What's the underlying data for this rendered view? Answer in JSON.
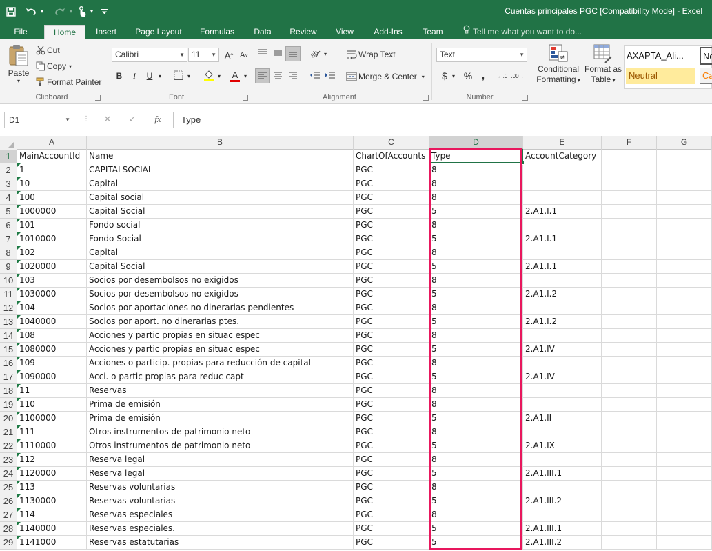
{
  "window": {
    "title": "Cuentas principales PGC  [Compatibility Mode] - Excel",
    "accent": "#217346",
    "highlight_color": "#e8175d"
  },
  "quick_access": {
    "save_icon": "save-icon",
    "undo_icon": "undo-icon",
    "redo_icon": "redo-icon",
    "touch_icon": "touch-mode-icon",
    "customize_icon": "customize-icon"
  },
  "tabs": [
    "File",
    "Home",
    "Insert",
    "Page Layout",
    "Formulas",
    "Data",
    "Review",
    "View",
    "Add-Ins",
    "Team"
  ],
  "active_tab": "Home",
  "tell_me": "Tell me what you want to do...",
  "ribbon": {
    "clipboard": {
      "paste": "Paste",
      "cut": "Cut",
      "copy": "Copy",
      "format_painter": "Format Painter",
      "label": "Clipboard"
    },
    "font": {
      "name": "Calibri",
      "size": "11",
      "label": "Font",
      "bold": "B",
      "italic": "I",
      "underline": "U",
      "grow": "A",
      "shrink": "A",
      "font_color_letter": "A"
    },
    "alignment": {
      "wrap_text": "Wrap Text",
      "merge_center": "Merge & Center",
      "label": "Alignment"
    },
    "number": {
      "format": "Text",
      "currency": "$",
      "percent": "%",
      "comma": ",",
      "increase_decimal": "←.0",
      "decrease_decimal": ".00→",
      "label": "Number"
    },
    "styles": {
      "conditional_formatting_1": "Conditional",
      "conditional_formatting_2": "Formatting",
      "format_as_table_1": "Format as",
      "format_as_table_2": "Table",
      "style_1": "AXAPTA_Ali...",
      "style_2": "Neutral",
      "style_3": "No",
      "style_4": "Ca"
    }
  },
  "formula_bar": {
    "name_box": "D1",
    "cancel": "✕",
    "enter": "✓",
    "fx": "fx",
    "content": "Type"
  },
  "sheet": {
    "columns": [
      "A",
      "B",
      "C",
      "D",
      "E",
      "F",
      "G"
    ],
    "selected_column": "D",
    "selected_cell": "D1",
    "row_numbers": [
      "1",
      "2",
      "3",
      "4",
      "5",
      "6",
      "7",
      "8",
      "9",
      "10",
      "11",
      "12",
      "13",
      "14",
      "15",
      "16",
      "17",
      "18",
      "19",
      "20",
      "21",
      "22",
      "23",
      "24",
      "25",
      "26",
      "27",
      "28",
      "29"
    ],
    "rows": [
      [
        "MainAccountId",
        "Name",
        "ChartOfAccounts",
        "Type",
        "AccountCategory",
        "",
        ""
      ],
      [
        "1",
        "CAPITALSOCIAL",
        "PGC",
        "8",
        "",
        "",
        ""
      ],
      [
        "10",
        "Capital",
        "PGC",
        "8",
        "",
        "",
        ""
      ],
      [
        "100",
        "Capital social",
        "PGC",
        "8",
        "",
        "",
        ""
      ],
      [
        "1000000",
        "Capital Social",
        "PGC",
        "5",
        "2.A1.I.1",
        "",
        ""
      ],
      [
        "101",
        "Fondo social",
        "PGC",
        "8",
        "",
        "",
        ""
      ],
      [
        "1010000",
        "Fondo Social",
        "PGC",
        "5",
        "2.A1.I.1",
        "",
        ""
      ],
      [
        "102",
        "Capital",
        "PGC",
        "8",
        "",
        "",
        ""
      ],
      [
        "1020000",
        "Capital Social",
        "PGC",
        "5",
        "2.A1.I.1",
        "",
        ""
      ],
      [
        "103",
        "Socios por desembolsos no exigidos",
        "PGC",
        "8",
        "",
        "",
        ""
      ],
      [
        "1030000",
        "Socios por desembolsos no exigidos",
        "PGC",
        "5",
        "2.A1.I.2",
        "",
        ""
      ],
      [
        "104",
        "Socios por aportaciones no dinerarias pendientes",
        "PGC",
        "8",
        "",
        "",
        ""
      ],
      [
        "1040000",
        "Socios por aport. no dinerarias ptes.",
        "PGC",
        "5",
        "2.A1.I.2",
        "",
        ""
      ],
      [
        "108",
        "Acciones y partic propias en situac espec",
        "PGC",
        "8",
        "",
        "",
        ""
      ],
      [
        "1080000",
        "Acciones y partic propias en situac espec",
        "PGC",
        "5",
        "2.A1.IV",
        "",
        ""
      ],
      [
        "109",
        "Acciones o particip. propias para reducción de capital",
        "PGC",
        "8",
        "",
        "",
        ""
      ],
      [
        "1090000",
        "Acci. o partic propias para reduc capt",
        "PGC",
        "5",
        "2.A1.IV",
        "",
        ""
      ],
      [
        "11",
        "Reservas",
        "PGC",
        "8",
        "",
        "",
        ""
      ],
      [
        "110",
        "Prima de emisión",
        "PGC",
        "8",
        "",
        "",
        ""
      ],
      [
        "1100000",
        "Prima de emisión",
        "PGC",
        "5",
        "2.A1.II",
        "",
        ""
      ],
      [
        "111",
        "Otros instrumentos de patrimonio neto",
        "PGC",
        "8",
        "",
        "",
        ""
      ],
      [
        "1110000",
        "Otros instrumentos de patrimonio neto",
        "PGC",
        "5",
        "2.A1.IX",
        "",
        ""
      ],
      [
        "112",
        "Reserva legal",
        "PGC",
        "8",
        "",
        "",
        ""
      ],
      [
        "1120000",
        "Reserva legal",
        "PGC",
        "5",
        "2.A1.III.1",
        "",
        ""
      ],
      [
        "113",
        "Reservas voluntarias",
        "PGC",
        "8",
        "",
        "",
        ""
      ],
      [
        "1130000",
        "Reservas voluntarias",
        "PGC",
        "5",
        "2.A1.III.2",
        "",
        ""
      ],
      [
        "114",
        "Reservas especiales",
        "PGC",
        "8",
        "",
        "",
        ""
      ],
      [
        "1140000",
        "Reservas especiales.",
        "PGC",
        "5",
        "2.A1.III.1",
        "",
        ""
      ],
      [
        "1141000",
        "Reservas estatutarias",
        "PGC",
        "5",
        "2.A1.III.2",
        "",
        ""
      ]
    ]
  }
}
